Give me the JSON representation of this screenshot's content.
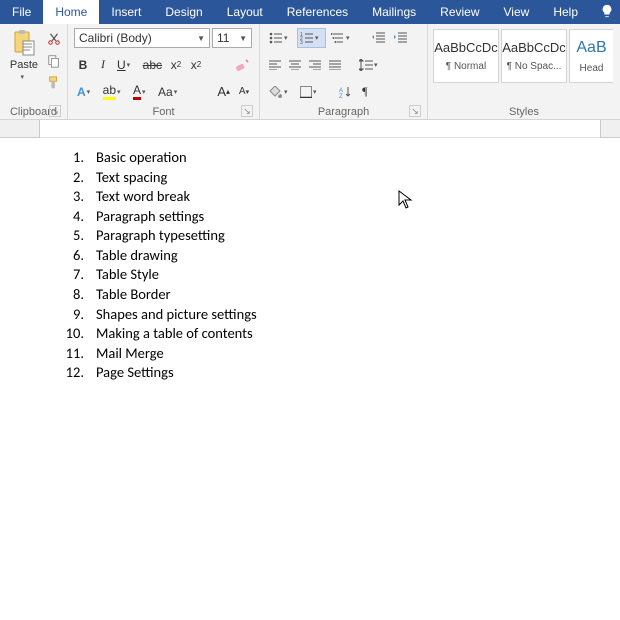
{
  "tabs": {
    "file": "File",
    "home": "Home",
    "insert": "Insert",
    "design": "Design",
    "layout": "Layout",
    "references": "References",
    "mailings": "Mailings",
    "review": "Review",
    "view": "View",
    "help": "Help"
  },
  "clipboard": {
    "label": "Clipboard",
    "paste": "Paste"
  },
  "font": {
    "label": "Font",
    "name": "Calibri (Body)",
    "size": "11",
    "bold": "B",
    "italic": "I",
    "underline": "U"
  },
  "paragraph": {
    "label": "Paragraph"
  },
  "styles": {
    "label": "Styles",
    "tiles": [
      {
        "prev": "AaBbCcDc",
        "name": "¶ Normal"
      },
      {
        "prev": "AaBbCcDc",
        "name": "¶ No Spac..."
      },
      {
        "prev": "AaB",
        "name": "Head"
      }
    ]
  },
  "list": [
    "Basic operation",
    "Text spacing",
    "Text word break",
    "Paragraph settings",
    "Paragraph typesetting",
    "Table drawing",
    "Table Style",
    "Table Border",
    "Shapes and picture settings",
    "Making a table of contents",
    "Mail Merge",
    "Page Settings"
  ]
}
